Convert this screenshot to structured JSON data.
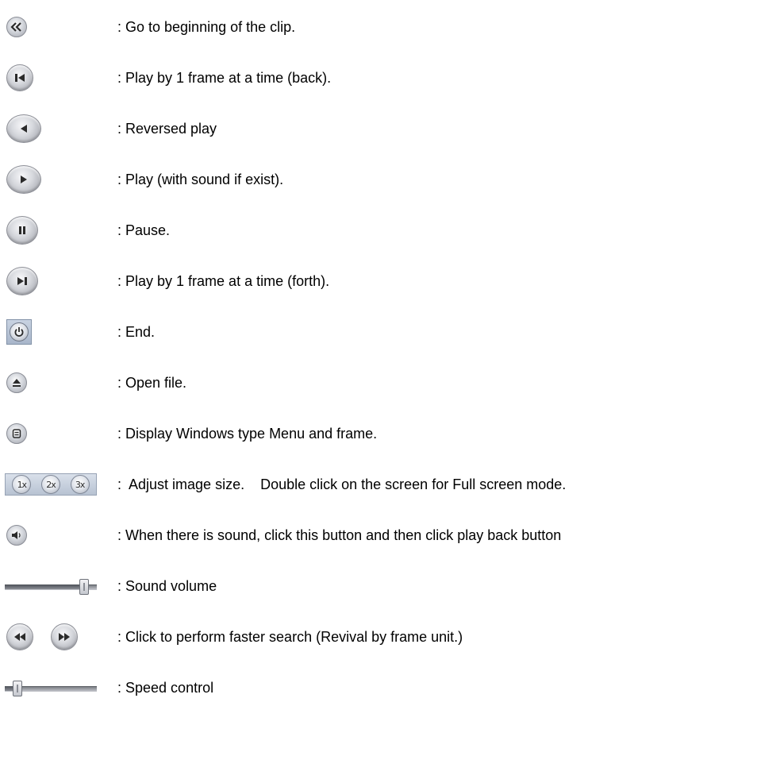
{
  "items": [
    {
      "icon": "rewind-to-start-icon",
      "text": ": Go to beginning of the clip."
    },
    {
      "icon": "frame-back-icon",
      "text": ": Play by 1 frame at a time (back)."
    },
    {
      "icon": "reverse-play-icon",
      "text": ": Reversed play"
    },
    {
      "icon": "play-icon",
      "text": ": Play (with sound if exist)."
    },
    {
      "icon": "pause-icon",
      "text": ": Pause."
    },
    {
      "icon": "frame-forward-icon",
      "text": ": Play by 1 frame at a time (forth)."
    },
    {
      "icon": "power-icon",
      "text": ": End."
    },
    {
      "icon": "eject-icon",
      "text": ": Open file."
    },
    {
      "icon": "menu-icon",
      "text": ": Display Windows type Menu and frame."
    },
    {
      "icon": "image-size-icon",
      "text": ":  Adjust image size.    Double click on the screen for Full screen mode.",
      "sizes": [
        "1x",
        "2x",
        "3x"
      ]
    },
    {
      "icon": "speaker-icon",
      "text": ": When there is sound, click this button and then click play back button"
    },
    {
      "icon": "volume-slider-icon",
      "text": ": Sound volume",
      "level": 0.9
    },
    {
      "icon": "fast-search-icon",
      "text": ": Click to perform faster search (Revival by frame unit.)"
    },
    {
      "icon": "speed-slider-icon",
      "text": ": Speed control",
      "level": 0.1
    }
  ],
  "colors": {
    "button_face": "#d7d9de",
    "square_button": "#b7c2d2",
    "glyph": "#2b2b2b",
    "text": "#000000"
  }
}
